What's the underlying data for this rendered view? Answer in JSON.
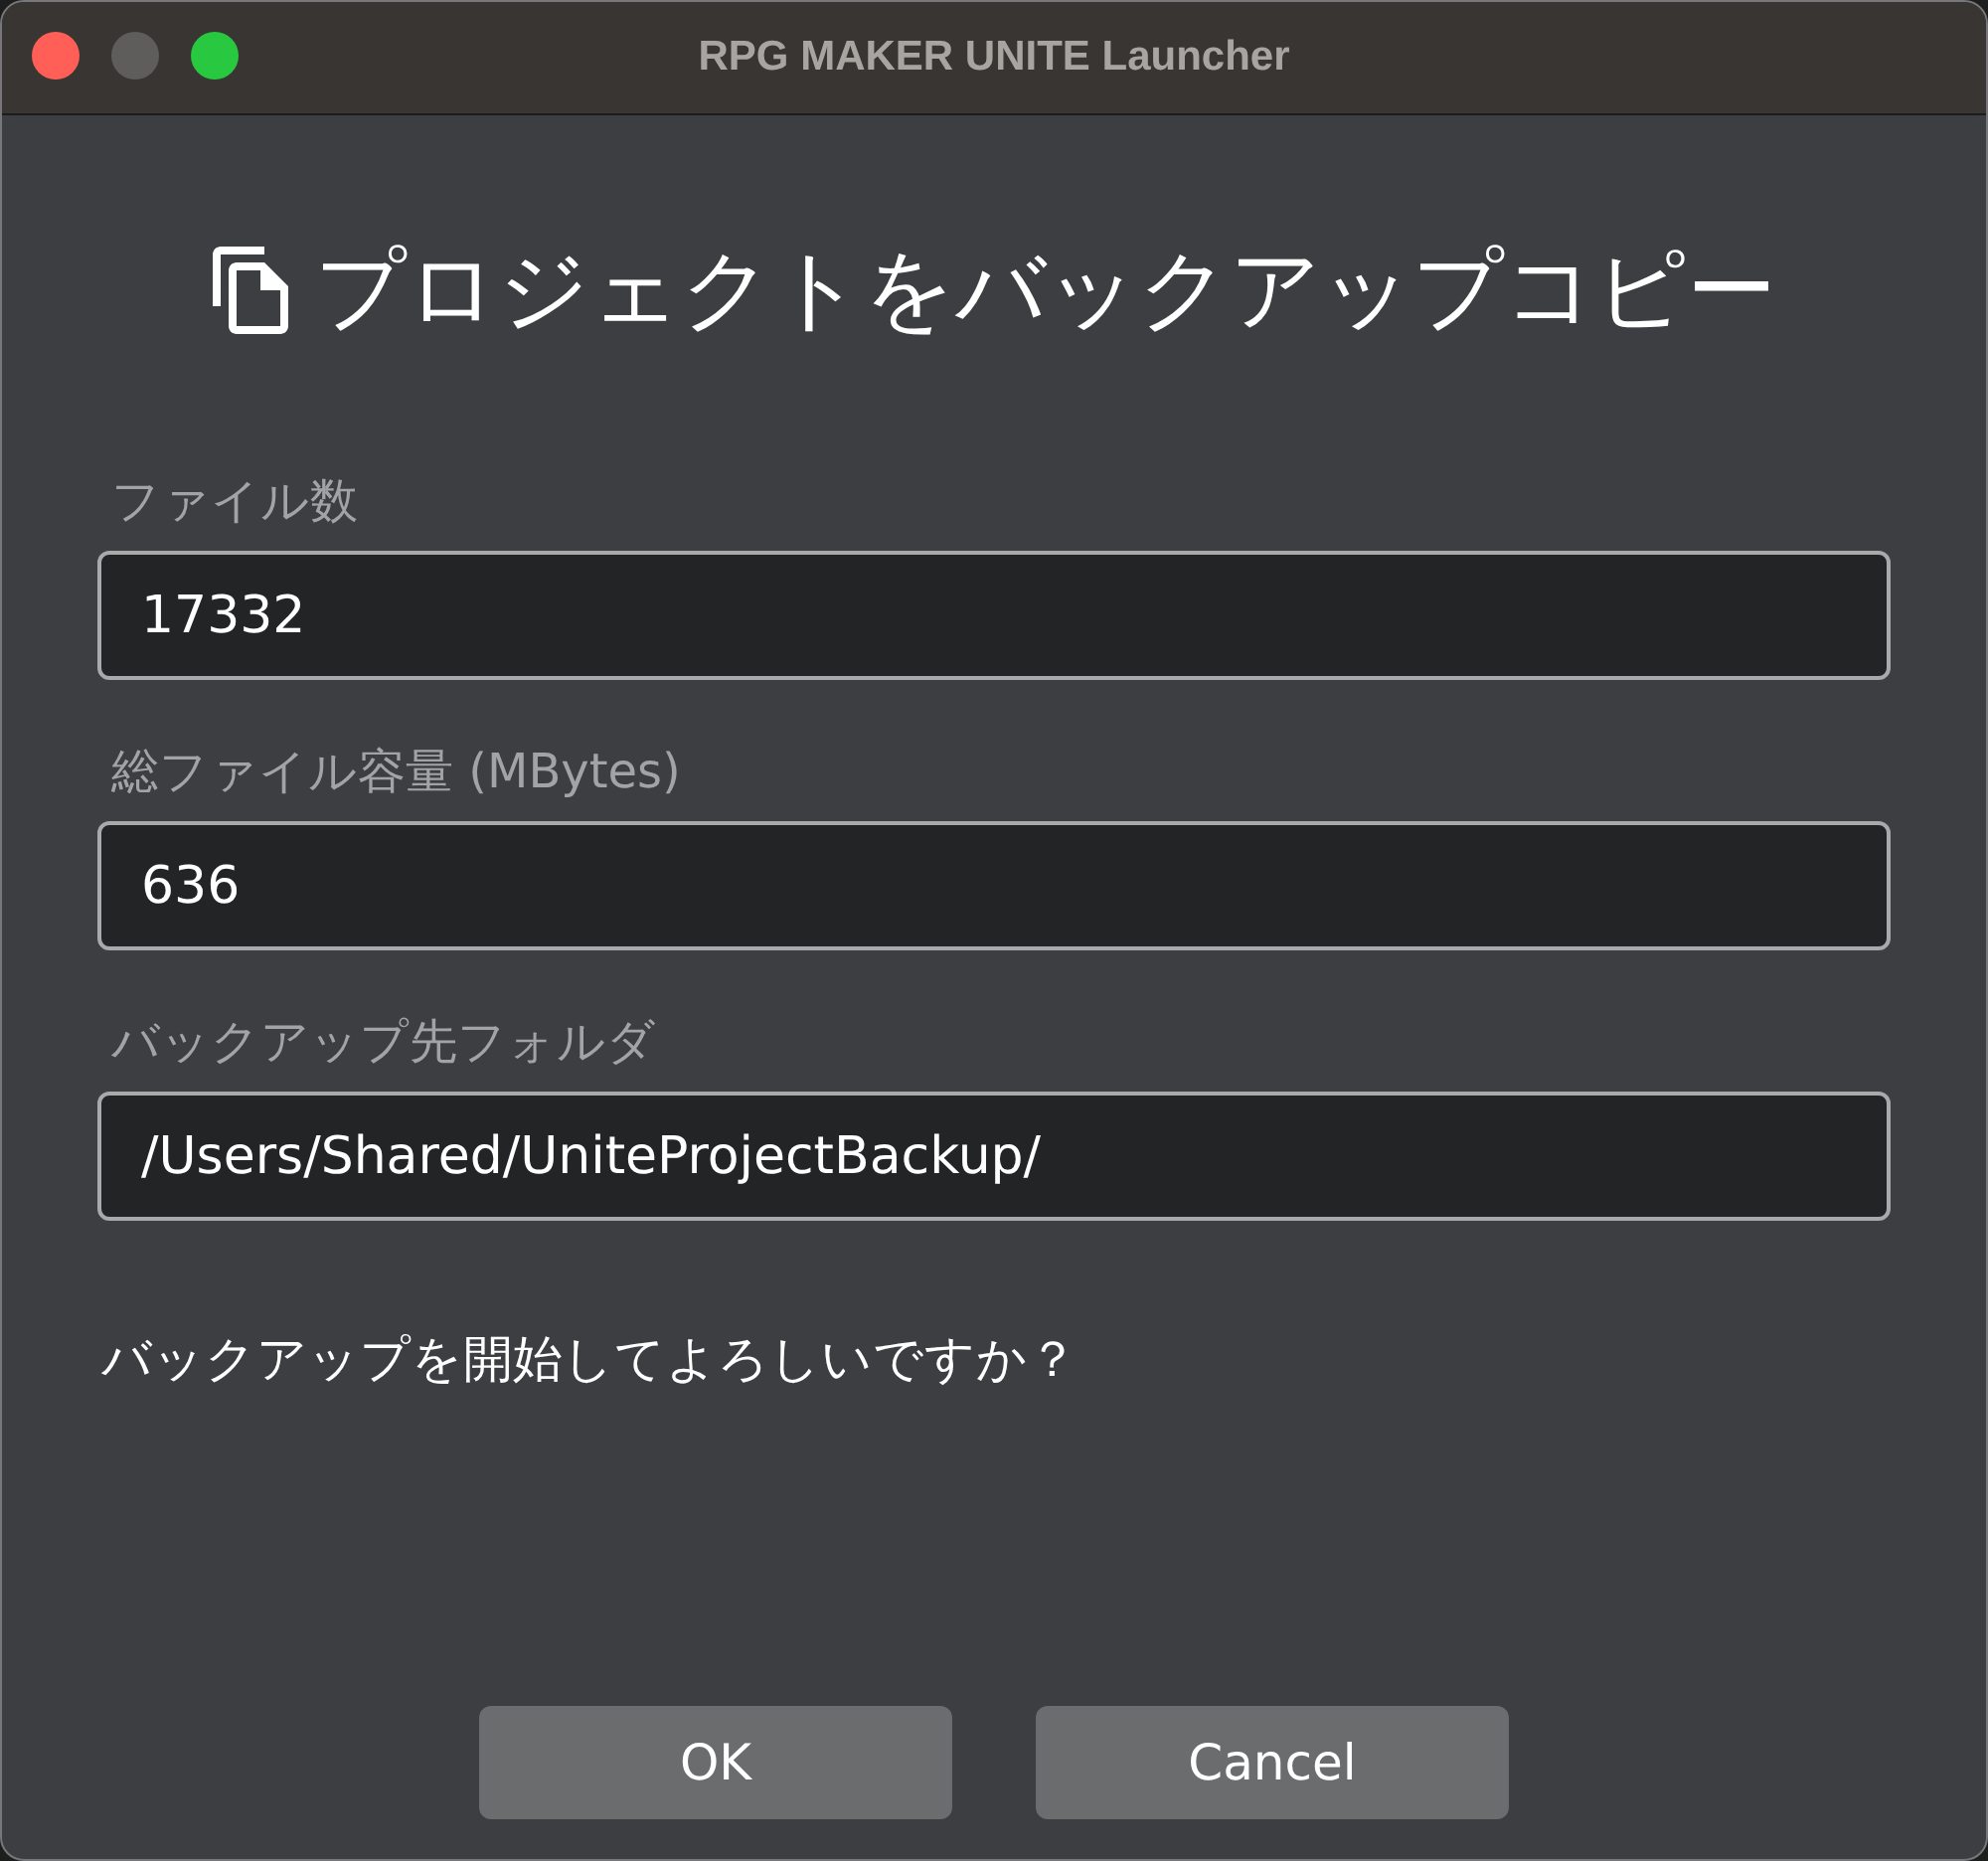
{
  "window": {
    "title": "RPG MAKER UNITE Launcher",
    "controls": [
      {
        "kind": "close",
        "disabled": false
      },
      {
        "kind": "minimize",
        "disabled": true
      },
      {
        "kind": "zoom",
        "disabled": false
      }
    ]
  },
  "dialog": {
    "heading": "プロジェクトをバックアップコピー",
    "fields": [
      {
        "label": "ファイル数",
        "value": "17332"
      },
      {
        "label": "総ファイル容量 (MBytes)",
        "value": "636"
      },
      {
        "label": "バックアップ先フォルダ",
        "value": "/Users/Shared/UniteProjectBackup/"
      }
    ],
    "message": "バックアップを開始してよろしいですか？",
    "buttons": [
      "OK",
      "Cancel"
    ]
  }
}
